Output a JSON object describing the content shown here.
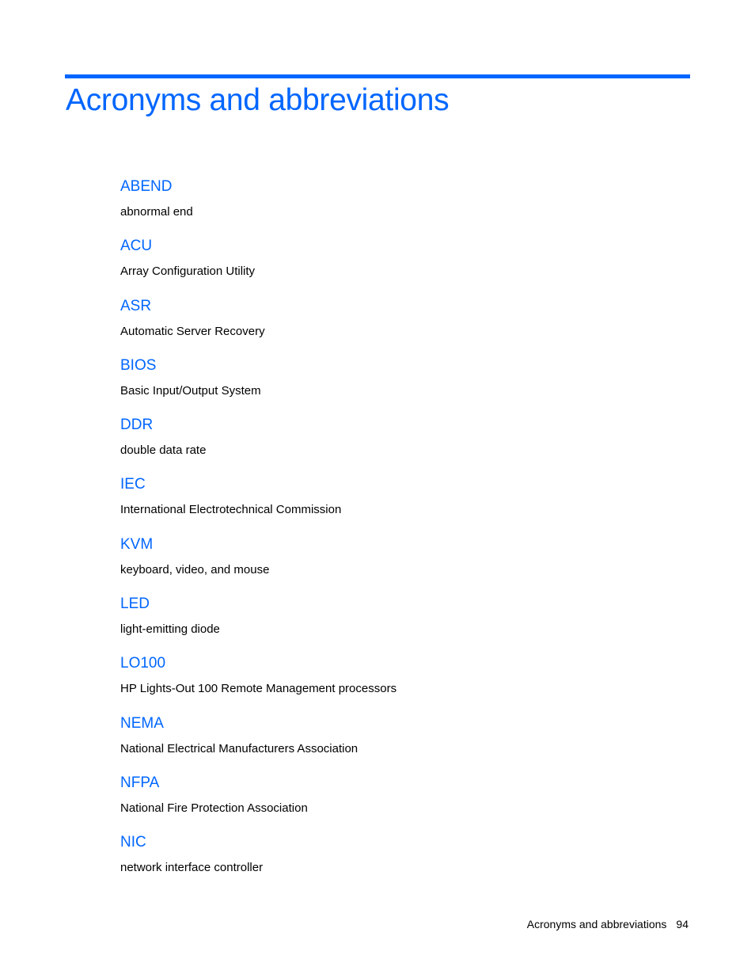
{
  "page": {
    "title": "Acronyms and abbreviations",
    "accent_color": "#0066ff"
  },
  "entries": [
    {
      "term": "ABEND",
      "definition": "abnormal end"
    },
    {
      "term": "ACU",
      "definition": "Array Configuration Utility"
    },
    {
      "term": "ASR",
      "definition": "Automatic Server Recovery"
    },
    {
      "term": "BIOS",
      "definition": "Basic Input/Output System"
    },
    {
      "term": "DDR",
      "definition": "double data rate"
    },
    {
      "term": "IEC",
      "definition": "International Electrotechnical Commission"
    },
    {
      "term": "KVM",
      "definition": "keyboard, video, and mouse"
    },
    {
      "term": "LED",
      "definition": "light-emitting diode"
    },
    {
      "term": "LO100",
      "definition": "HP Lights-Out 100 Remote Management processors"
    },
    {
      "term": "NEMA",
      "definition": "National Electrical Manufacturers Association"
    },
    {
      "term": "NFPA",
      "definition": "National Fire Protection Association"
    },
    {
      "term": "NIC",
      "definition": "network interface controller"
    }
  ],
  "footer": {
    "section": "Acronyms and abbreviations",
    "page_number": "94"
  }
}
